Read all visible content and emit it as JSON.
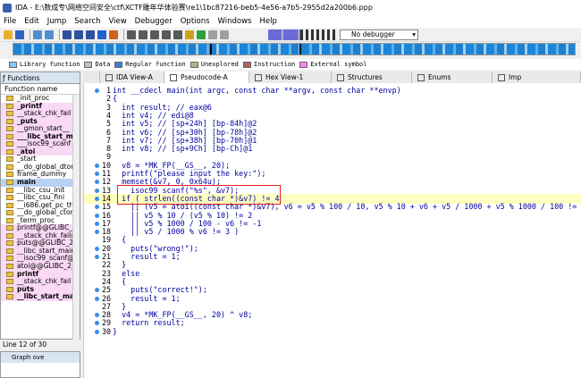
{
  "window": {
    "title": "IDA - E:\\数成专\\网络空间安全\\ctf\\XCTF雕年华体验赛\\re1\\1bc87216-beb5-4e56-a7b5-2955d2a200b6.ppp"
  },
  "menu": [
    "File",
    "Edit",
    "Jump",
    "Search",
    "View",
    "Debugger",
    "Options",
    "Windows",
    "Help"
  ],
  "debugger_select": {
    "value": "No debugger"
  },
  "legend": [
    {
      "label": "Library function",
      "color": "#7fd0f4"
    },
    {
      "label": "Data",
      "color": "#c0c0c0"
    },
    {
      "label": "Regular function",
      "color": "#3f7fd6"
    },
    {
      "label": "Unexplored",
      "color": "#b5b08a"
    },
    {
      "label": "Instruction",
      "color": "#b06060"
    },
    {
      "label": "External symbol",
      "color": "#f48af0"
    }
  ],
  "functions_panel": {
    "title": "Functions",
    "column_header": "Function name",
    "items": [
      {
        "name": "_init_proc",
        "style": "normal"
      },
      {
        "name": "_printf",
        "style": "pink-bold"
      },
      {
        "name": "__stack_chk_fail",
        "style": "pink"
      },
      {
        "name": "_puts",
        "style": "pink-bold"
      },
      {
        "name": "__gmon_start__",
        "style": "pink"
      },
      {
        "name": "___libc_start_main",
        "style": "pink-bold"
      },
      {
        "name": "___isoc99_scanf",
        "style": "pink"
      },
      {
        "name": "_atoi",
        "style": "pink-bold"
      },
      {
        "name": "_start",
        "style": "normal"
      },
      {
        "name": "__do_global_dtors_a",
        "style": "normal"
      },
      {
        "name": "frame_dummy",
        "style": "normal"
      },
      {
        "name": "main",
        "style": "selected-bold"
      },
      {
        "name": "__libc_csu_init",
        "style": "normal"
      },
      {
        "name": "__libc_csu_fini",
        "style": "normal"
      },
      {
        "name": "__i686.get_pc_thunk",
        "style": "normal"
      },
      {
        "name": "__do_global_ctors_a",
        "style": "normal"
      },
      {
        "name": "_term_proc",
        "style": "normal"
      },
      {
        "name": "printf@@GLIBC_2_0",
        "style": "pink"
      },
      {
        "name": "__stack_chk_fail@@G",
        "style": "pink"
      },
      {
        "name": "puts@@GLIBC_2_0",
        "style": "pink"
      },
      {
        "name": "__libc_start_main@@",
        "style": "pink"
      },
      {
        "name": "__isoc99_scanf@@GI",
        "style": "pink"
      },
      {
        "name": "atoi@@GLIBC_2_0",
        "style": "pink"
      },
      {
        "name": "printf",
        "style": "pink-bold"
      },
      {
        "name": "__stack_chk_fail",
        "style": "pink"
      },
      {
        "name": "puts",
        "style": "pink-bold"
      },
      {
        "name": "__libc_start_main",
        "style": "pink-bold"
      }
    ]
  },
  "status": {
    "text": "Line 12 of 30"
  },
  "graph_overview": {
    "title": "Graph ove"
  },
  "tabs": [
    {
      "label": "IDA View-A",
      "active": false
    },
    {
      "label": "Pseudocode-A",
      "active": true
    },
    {
      "label": "Hex View-1",
      "active": false
    },
    {
      "label": "Structures",
      "active": false
    },
    {
      "label": "Enums",
      "active": false
    },
    {
      "label": "Imp",
      "active": false
    }
  ],
  "code_lines": [
    {
      "n": "1",
      "dot": true,
      "text": "int __cdecl main(int argc, const char **argv, const char **envp)"
    },
    {
      "n": "2",
      "dot": false,
      "text": "{"
    },
    {
      "n": "3",
      "dot": false,
      "text": "  int result; // eax@6"
    },
    {
      "n": "4",
      "dot": false,
      "text": "  int v4; // edi@8"
    },
    {
      "n": "5",
      "dot": false,
      "text": "  int v5; // [sp+24h] [bp-84h]@2"
    },
    {
      "n": "6",
      "dot": false,
      "text": "  int v6; // [sp+30h] [bp-78h]@2"
    },
    {
      "n": "7",
      "dot": false,
      "text": "  int v7; // [sp+38h] [bp-70h]@1"
    },
    {
      "n": "8",
      "dot": false,
      "text": "  int v8; // [sp+9Ch] [bp-Ch]@1"
    },
    {
      "n": "9",
      "dot": false,
      "text": ""
    },
    {
      "n": "10",
      "dot": true,
      "text": "  v8 = *MK_FP(__GS__, 20);"
    },
    {
      "n": "11",
      "dot": true,
      "text": "  printf(\"please input the key:\");"
    },
    {
      "n": "12",
      "dot": true,
      "text": "  memset(&v7, 0, 0x64u);"
    },
    {
      "n": "13",
      "dot": true,
      "text": "  __isoc99_scanf(\"%s\", &v7);"
    },
    {
      "n": "14",
      "dot": true,
      "text": "  if ( strlen((const char *)&v7) != 4"
    },
    {
      "n": "15",
      "dot": true,
      "text": "    || (v5 = atoi((const char *)&v7), v6 = v5 % 100 / 10, v5 % 10 + v6 + v5 / 1000 + v5 % 1000 / 100 != 23)"
    },
    {
      "n": "16",
      "dot": true,
      "text": "    || v5 % 10 / (v5 % 10) != 2"
    },
    {
      "n": "17",
      "dot": true,
      "text": "    || v5 % 1000 / 100 - v6 != -1"
    },
    {
      "n": "18",
      "dot": true,
      "text": "    || v5 / 1000 % v6 != 3 )"
    },
    {
      "n": "19",
      "dot": false,
      "text": "  {"
    },
    {
      "n": "20",
      "dot": true,
      "text": "    puts(\"wrong!\");"
    },
    {
      "n": "21",
      "dot": true,
      "text": "    result = 1;"
    },
    {
      "n": "22",
      "dot": false,
      "text": "  }"
    },
    {
      "n": "23",
      "dot": false,
      "text": "  else"
    },
    {
      "n": "24",
      "dot": false,
      "text": "  {"
    },
    {
      "n": "25",
      "dot": true,
      "text": "    puts(\"correct!\");"
    },
    {
      "n": "26",
      "dot": true,
      "text": "    result = 1;"
    },
    {
      "n": "27",
      "dot": false,
      "text": "  }"
    },
    {
      "n": "28",
      "dot": true,
      "text": "  v4 = *MK_FP(__GS__, 20) ^ v8;"
    },
    {
      "n": "29",
      "dot": true,
      "text": "  return result;"
    },
    {
      "n": "30",
      "dot": true,
      "text": "}"
    }
  ]
}
